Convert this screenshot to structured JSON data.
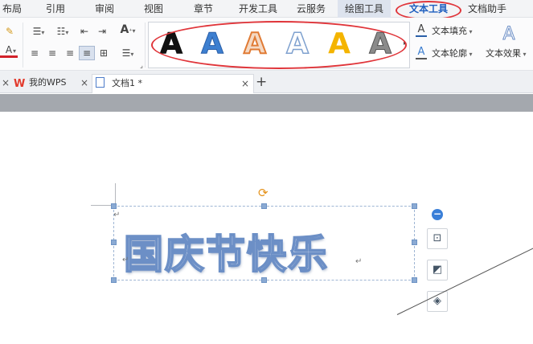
{
  "menu": {
    "tabs": [
      {
        "label": "布局"
      },
      {
        "label": "引用"
      },
      {
        "label": "审阅"
      },
      {
        "label": "视图"
      },
      {
        "label": "章节"
      },
      {
        "label": "开发工具"
      },
      {
        "label": "云服务"
      },
      {
        "label": "绘图工具"
      },
      {
        "label": "文本工具"
      },
      {
        "label": "文档助手"
      }
    ]
  },
  "ribbon": {
    "wordart_letter": "A",
    "font_size_up": "A",
    "text_fill_label": "文本填充",
    "text_outline_label": "文本轮廓",
    "text_effect_label": "文本效果",
    "styles": [
      {
        "color": "#111111",
        "stroke": "#111111"
      },
      {
        "color": "#3d7fd0",
        "stroke": "#2a5fa8"
      },
      {
        "color": "#f4d9c4",
        "stroke": "#e07b35"
      },
      {
        "color": "#ffffff",
        "stroke": "#7fa1cf"
      },
      {
        "color": "#f4b400",
        "stroke": "#f4b400"
      },
      {
        "color": "#8a8a8a",
        "stroke": "#555555"
      }
    ]
  },
  "tabs": {
    "wps_label": "我的WPS",
    "doc_label": "文档1 *",
    "close": "×",
    "add": "+"
  },
  "document": {
    "art_text": "国庆节快乐",
    "para_mark": "↵"
  },
  "colors": {
    "accent": "#1e5fbf",
    "highlight_oval": "#e0353a"
  }
}
